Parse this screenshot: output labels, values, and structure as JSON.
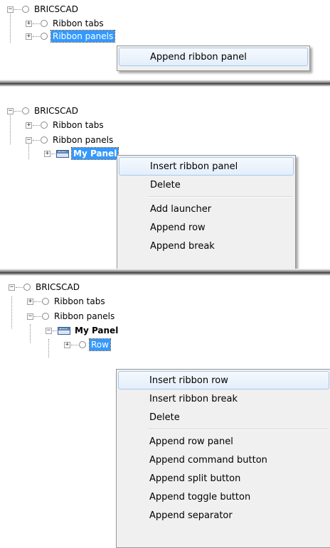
{
  "colors": {
    "selection": "#3399ff",
    "menu_bg": "#f0f0f0",
    "menu_highlight_border": "#a8c8ec"
  },
  "icons": {
    "expanded": "−",
    "collapsed": "+"
  },
  "panel1": {
    "tree": {
      "root": "BRICSCAD",
      "ribbon_tabs": "Ribbon tabs",
      "ribbon_panels": "Ribbon panels"
    },
    "menu": {
      "items": [
        "Append ribbon panel"
      ]
    }
  },
  "panel2": {
    "tree": {
      "root": "BRICSCAD",
      "ribbon_tabs": "Ribbon tabs",
      "ribbon_panels": "Ribbon panels",
      "my_panel": "My Panel"
    },
    "menu": {
      "items": [
        "Insert ribbon panel",
        "Delete",
        "Add launcher",
        "Append row",
        "Append break"
      ]
    }
  },
  "panel3": {
    "tree": {
      "root": "BRICSCAD",
      "ribbon_tabs": "Ribbon tabs",
      "ribbon_panels": "Ribbon panels",
      "my_panel": "My Panel",
      "row": "Row"
    },
    "menu": {
      "items": [
        "Insert ribbon row",
        "Insert ribbon break",
        "Delete",
        "Append row panel",
        "Append command button",
        "Append split button",
        "Append toggle button",
        "Append separator"
      ]
    }
  }
}
